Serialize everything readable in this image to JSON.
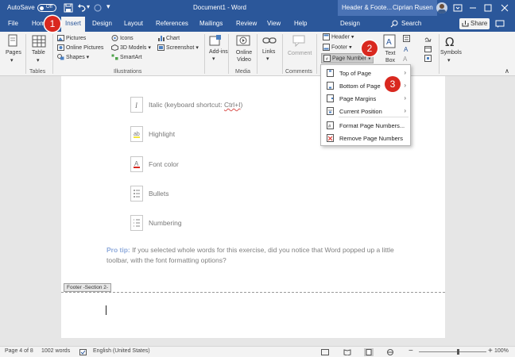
{
  "titlebar": {
    "autosave_label": "AutoSave",
    "autosave_state": "Off",
    "document_title": "Document1 - Word",
    "context_title": "Header & Foote...",
    "user_name": "Ciprian Rusen"
  },
  "tabs": {
    "file": "File",
    "home": "Home",
    "insert": "Insert",
    "design": "Design",
    "layout": "Layout",
    "references": "References",
    "mailings": "Mailings",
    "review": "Review",
    "view": "View",
    "help": "Help",
    "hf_design": "Design",
    "search": "Search",
    "share": "Share"
  },
  "ribbon": {
    "pages": "Pages",
    "table": "Table",
    "tables_group": "Tables",
    "pictures": "Pictures",
    "online_pictures": "Online Pictures",
    "shapes": "Shapes",
    "icons": "Icons",
    "models_3d": "3D Models",
    "smartart": "SmartArt",
    "chart": "Chart",
    "screenshot": "Screenshot",
    "illustrations_group": "Illustrations",
    "addins": "Add-ins",
    "online_video": "Online Video",
    "media_group": "Media",
    "links": "Links",
    "comment": "Comment",
    "comments_group": "Comments",
    "header": "Header",
    "footer": "Footer",
    "page_number": "Page Number",
    "text_box": "Text Box",
    "symbols": "Symbols"
  },
  "menu": {
    "items": [
      {
        "label": "Top of Page",
        "has_submenu": true
      },
      {
        "label": "Bottom of Page",
        "has_submenu": true
      },
      {
        "label": "Page Margins",
        "has_submenu": true
      },
      {
        "label": "Current Position",
        "has_submenu": true
      },
      {
        "label": "Format Page Numbers...",
        "has_submenu": false
      },
      {
        "label": "Remove Page Numbers",
        "has_submenu": false
      }
    ]
  },
  "document": {
    "list": [
      {
        "text": "Italic (keyboard shortcut: ",
        "shortcut": "Ctrl+I",
        "close": ")"
      },
      {
        "text": "Highlight"
      },
      {
        "text": "Font color"
      },
      {
        "text": "Bullets"
      },
      {
        "text": "Numbering"
      }
    ],
    "protip_label": "Pro tip:",
    "protip_text": " If you selected whole words for this exercise, did you notice that Word popped up a little toolbar, with the font formatting options?",
    "footer_tag": "Footer -Section 2-"
  },
  "status": {
    "page": "Page 4 of 8",
    "words": "1002 words",
    "language": "English (United States)",
    "zoom": "100%",
    "zoom_minus": "−",
    "zoom_plus": "+"
  },
  "badges": {
    "one": "1",
    "two": "2",
    "three": "3"
  },
  "colors": {
    "word_blue": "#2b579a",
    "badge_red": "#d9281f",
    "protip_blue": "#8eaadb"
  }
}
